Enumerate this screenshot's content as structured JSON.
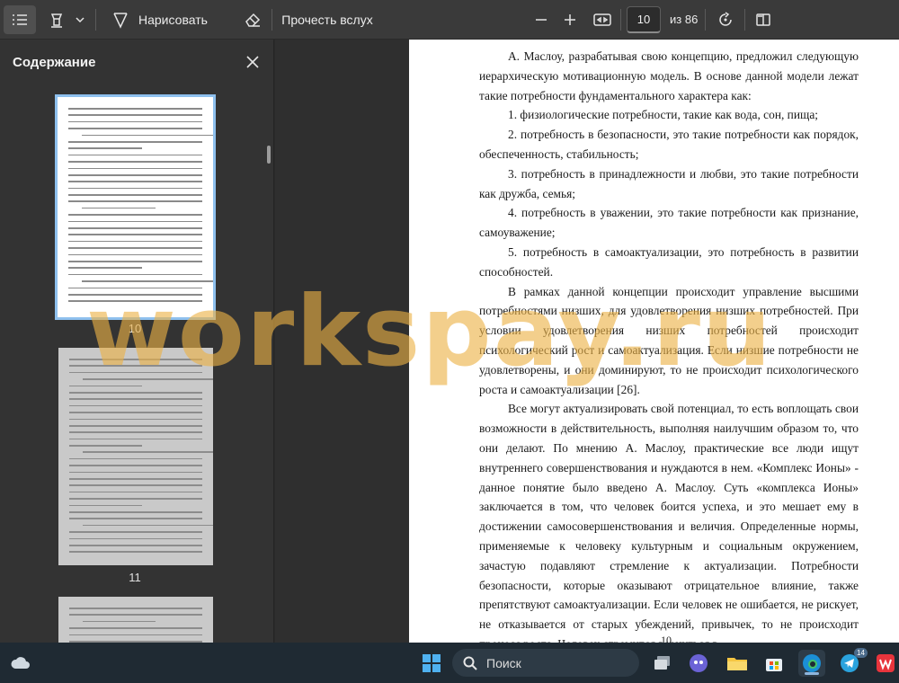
{
  "toolbar": {
    "draw_label": "Нарисовать",
    "read_aloud_label": "Прочесть вслух",
    "page_number": "10",
    "page_total": "из 86"
  },
  "sidebar": {
    "title": "Содержание",
    "thumbnails": [
      {
        "page": "10"
      },
      {
        "page": "11"
      }
    ]
  },
  "document": {
    "paragraphs": [
      "А. Маслоу, разрабатывая свою концепцию, предложил следующую иерархическую мотивационную модель. В основе данной модели лежат такие потребности фундаментального характера как:",
      "1. физиологические потребности, такие как вода, сон, пища;",
      "2. потребность в безопасности, это такие потребности как порядок, обеспеченность, стабильность;",
      "3. потребность в принадлежности и любви, это такие потребности как дружба, семья;",
      "4. потребность в уважении, это такие потребности как признание, самоуважение;",
      "5. потребность в самоактуализации, это потребность в развитии способностей.",
      "В рамках данной концепции происходит управление высшими потребностями низших, для удовлетворения низших потребностей. При условии удовлетворения низших потребностей происходит психологический рост и самоактуализация. Если низшие потребности не удовлетворены, и они доминируют, то не происходит психологического роста и самоактуализации [26].",
      "Все могут актуализировать свой потенциал, то есть воплощать свои возможности в действительность, выполняя наилучшим образом то, что они делают. По мнению А. Маслоу, практические все люди ищут внутреннего совершенствования и нуждаются в нем. «Комплекс Ионы» - данное понятие было введено А. Маслоу. Суть «комплекса Ионы» заключается в том, что человек боится успеха, и это мешает ему в достижении самосовершенствования и величия. Определенные нормы, применяемые к человеку культурным и социальным окружением, зачастую подавляют стремление к актуализации. Потребности безопасности, которые оказывают отрицательное влияние, также препятствуют самоактуализации. Если человек не ошибается, не рискует, не отказывается от старых убеждений, привычек, то не происходит процесс роста. Человек стремится вернуться в"
    ],
    "footer_page": "10"
  },
  "watermark": "workspay.ru",
  "taskbar": {
    "search_placeholder": "Поиск",
    "telegram_badge": "14"
  },
  "colors": {
    "toolbar_bg": "#3a3a3a",
    "sidebar_bg": "#333333",
    "selection_outline": "#8ec0ee",
    "watermark": "#ecb246",
    "taskbar_bg": "#1f2a33"
  }
}
